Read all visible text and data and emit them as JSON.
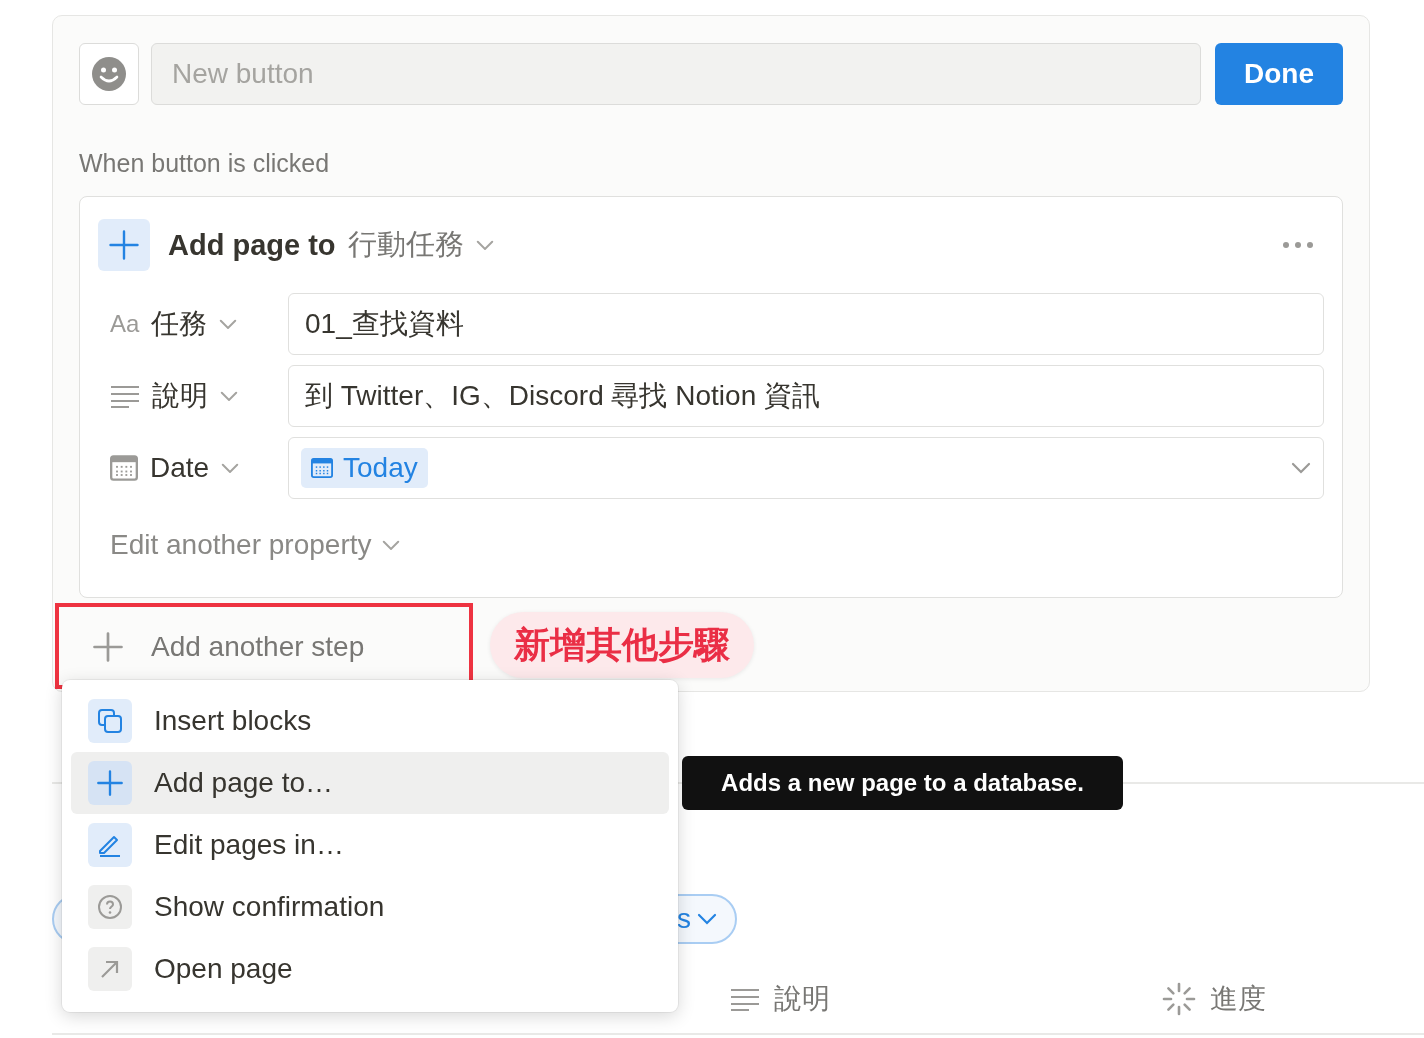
{
  "editor": {
    "name_field": {
      "placeholder": "New button"
    },
    "done_button": "Done"
  },
  "trigger_label": "When button is clicked",
  "action": {
    "title": "Add page to",
    "database": "行動任務",
    "properties": [
      {
        "kind": "title",
        "glyph": "Aa",
        "name": "任務",
        "value": "01_查找資料"
      },
      {
        "kind": "text",
        "name": "說明",
        "value": "到 Twitter、IG、Discord 尋找 Notion 資訊"
      },
      {
        "kind": "date",
        "name": "Date",
        "value": "Today"
      }
    ],
    "edit_another": "Edit another property"
  },
  "add_step": "Add another step",
  "annotation": "新增其他步驟",
  "step_menu": [
    {
      "kind": "blocks",
      "label": "Insert blocks",
      "selected": false
    },
    {
      "kind": "add",
      "label": "Add page to…",
      "selected": true
    },
    {
      "kind": "edit",
      "label": "Edit pages in…",
      "selected": false
    },
    {
      "kind": "confirm",
      "label": "Show confirmation",
      "selected": false
    },
    {
      "kind": "open",
      "label": "Open page",
      "selected": false
    }
  ],
  "tooltip": "Adds a new page to a database.",
  "background": {
    "filter_pill": "s",
    "columns": [
      {
        "kind": "text",
        "label": "說明"
      },
      {
        "kind": "status",
        "label": "進度"
      }
    ]
  }
}
